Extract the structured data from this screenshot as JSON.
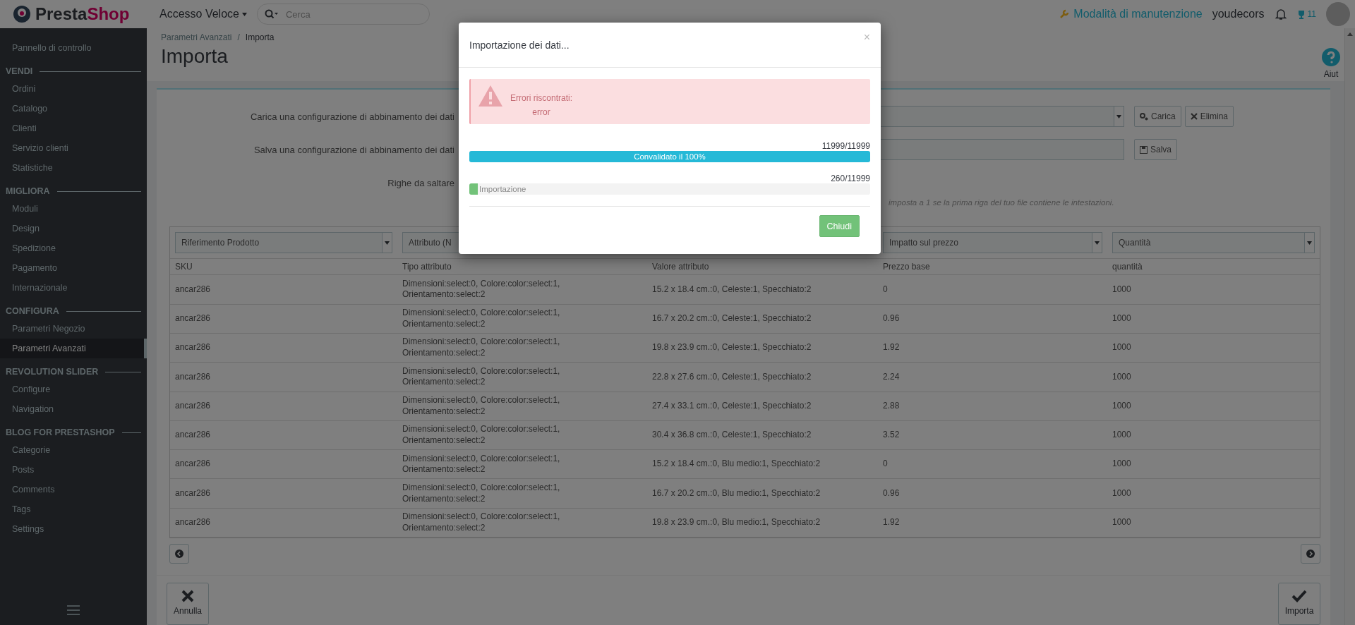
{
  "header": {
    "logo_left": "Presta",
    "logo_right": "Shop",
    "quick_access": "Accesso Veloce",
    "search": {
      "placeholder": "Cerca"
    },
    "maintenance": "Modalità di manutenzione",
    "shop_name": "youdecors",
    "trophy_count": "11"
  },
  "sidebar": {
    "dashboard": "Pannello di controllo",
    "sections": [
      {
        "title": "VENDI",
        "items": [
          {
            "label": "Ordini",
            "selected": false
          },
          {
            "label": "Catalogo",
            "selected": false
          },
          {
            "label": "Clienti",
            "selected": false
          },
          {
            "label": "Servizio clienti",
            "selected": false
          },
          {
            "label": "Statistiche",
            "selected": false
          }
        ]
      },
      {
        "title": "MIGLIORA",
        "items": [
          {
            "label": "Moduli",
            "selected": false
          },
          {
            "label": "Design",
            "selected": false
          },
          {
            "label": "Spedizione",
            "selected": false
          },
          {
            "label": "Pagamento",
            "selected": false
          },
          {
            "label": "Internazionale",
            "selected": false
          }
        ]
      },
      {
        "title": "CONFIGURA",
        "items": [
          {
            "label": "Parametri Negozio",
            "selected": false
          },
          {
            "label": "Parametri Avanzati",
            "selected": true
          }
        ]
      },
      {
        "title": "REVOLUTION SLIDER",
        "items": [
          {
            "label": "Configure",
            "selected": false
          },
          {
            "label": "Navigation",
            "selected": false
          }
        ]
      },
      {
        "title": "BLOG FOR PRESTASHOP",
        "items": [
          {
            "label": "Categorie",
            "selected": false
          },
          {
            "label": "Posts",
            "selected": false
          },
          {
            "label": "Comments",
            "selected": false
          },
          {
            "label": "Tags",
            "selected": false
          },
          {
            "label": "Settings",
            "selected": false
          }
        ]
      }
    ]
  },
  "breadcrumb": [
    "Parametri Avanzati",
    "Importa"
  ],
  "breadcrumb_separator": "/",
  "page_title": "Importa",
  "help_label": "Aiut",
  "form": {
    "load_label": "Carica una configurazione di abbinamento dei dati",
    "load_buttons": [
      "Carica",
      "Elimina"
    ],
    "save_label": "Salva una configurazione di abbinamento dei dati",
    "save_button": "Salva",
    "skip_label": "Righe da saltare",
    "skip_hint": "imposta a 1 se la prima riga del tuo file contiene le intestazioni."
  },
  "mapping_selects": [
    {
      "label": "Riferimento Prodotto"
    },
    {
      "label": "Attributo (N"
    },
    {
      "label": "Impatto sul prezzo"
    },
    {
      "label": "Quantità"
    }
  ],
  "table": {
    "columns": [
      "SKU",
      "Tipo attributo",
      "Valore attributo",
      "Prezzo base",
      "quantità"
    ],
    "rows": [
      [
        "ancar286",
        "Dimensioni:select:0, Colore:color:select:1, Orientamento:select:2",
        "15.2 x 18.4 cm.:0, Celeste:1, Specchiato:2",
        "0",
        "1000"
      ],
      [
        "ancar286",
        "Dimensioni:select:0, Colore:color:select:1, Orientamento:select:2",
        "16.7 x 20.2 cm.:0, Celeste:1, Specchiato:2",
        "0.96",
        "1000"
      ],
      [
        "ancar286",
        "Dimensioni:select:0, Colore:color:select:1, Orientamento:select:2",
        "19.8 x 23.9 cm.:0, Celeste:1, Specchiato:2",
        "1.92",
        "1000"
      ],
      [
        "ancar286",
        "Dimensioni:select:0, Colore:color:select:1, Orientamento:select:2",
        "22.8 x 27.6 cm.:0, Celeste:1, Specchiato:2",
        "2.24",
        "1000"
      ],
      [
        "ancar286",
        "Dimensioni:select:0, Colore:color:select:1, Orientamento:select:2",
        "27.4 x 33.1 cm.:0, Celeste:1, Specchiato:2",
        "2.88",
        "1000"
      ],
      [
        "ancar286",
        "Dimensioni:select:0, Colore:color:select:1, Orientamento:select:2",
        "30.4 x 36.8 cm.:0, Celeste:1, Specchiato:2",
        "3.52",
        "1000"
      ],
      [
        "ancar286",
        "Dimensioni:select:0, Colore:color:select:1, Orientamento:select:2",
        "15.2 x 18.4 cm.:0, Blu medio:1, Specchiato:2",
        "0",
        "1000"
      ],
      [
        "ancar286",
        "Dimensioni:select:0, Colore:color:select:1, Orientamento:select:2",
        "16.7 x 20.2 cm.:0, Blu medio:1, Specchiato:2",
        "0.96",
        "1000"
      ],
      [
        "ancar286",
        "Dimensioni:select:0, Colore:color:select:1, Orientamento:select:2",
        "19.8 x 23.9 cm.:0, Blu medio:1, Specchiato:2",
        "1.92",
        "1000"
      ]
    ]
  },
  "footer_buttons": [
    "Annulla",
    "Importa"
  ],
  "modal": {
    "title": "Importazione dei dati...",
    "close": "×",
    "alert": {
      "title": "Errori riscontrati:",
      "message": "error"
    },
    "progress": [
      {
        "kind": "validate",
        "count": "11999/11999",
        "label": "Convalidato il 100%",
        "level": 1
      },
      {
        "kind": "import",
        "count": "260/11999",
        "label": "Importazione",
        "level": 0.022
      }
    ],
    "button": "Chiudi"
  }
}
